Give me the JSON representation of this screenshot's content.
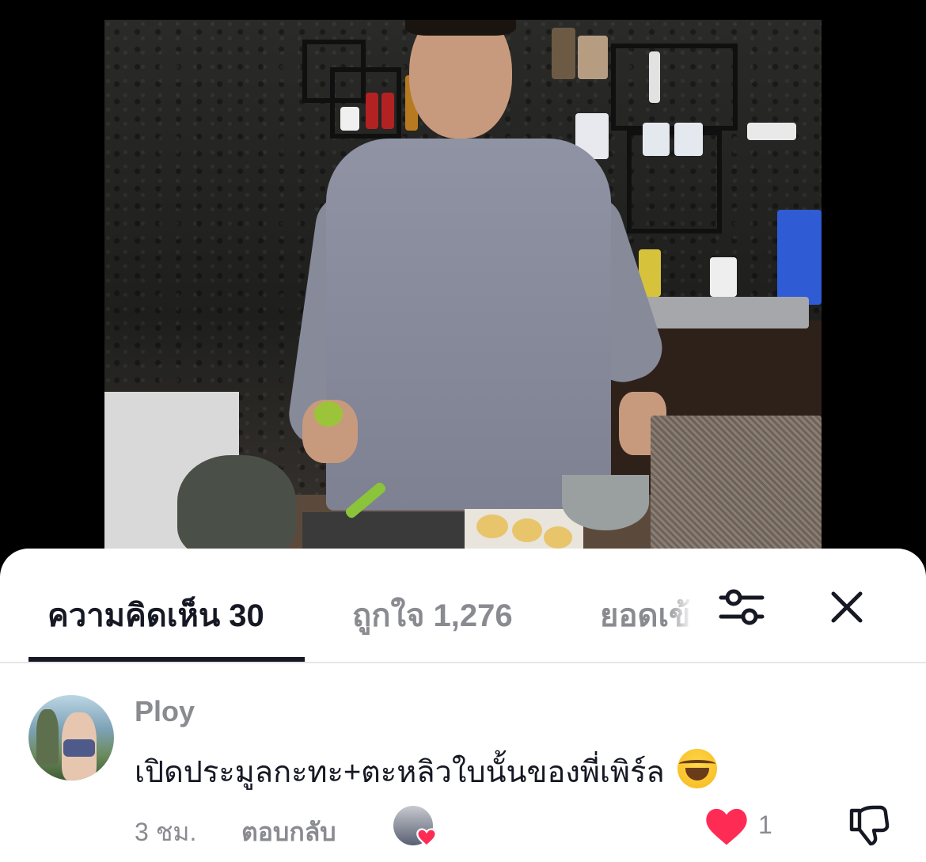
{
  "video": {
    "description_icon": "cooking-video-frame"
  },
  "tabs": {
    "comments_label": "ความคิดเห็น 30",
    "likes_label": "ถูกใจ 1,276",
    "views_label": "ยอดเข้าชม",
    "active": "comments"
  },
  "toolbar": {
    "filter_icon": "sliders-icon",
    "close_icon": "close-icon"
  },
  "comment": {
    "username": "Ploy",
    "text": "เปิดประมูลกะทะ+ตะหลิวใบนั้นของพี่เพิร์ล",
    "emoji": "😂",
    "time": "3 ชม.",
    "reply_label": "ตอบกลับ",
    "like_count": "1",
    "liked": true,
    "liked_by_creator": true
  },
  "colors": {
    "accent_red": "#fe2c55",
    "text_primary": "#161823",
    "text_secondary": "#8a8b91"
  }
}
